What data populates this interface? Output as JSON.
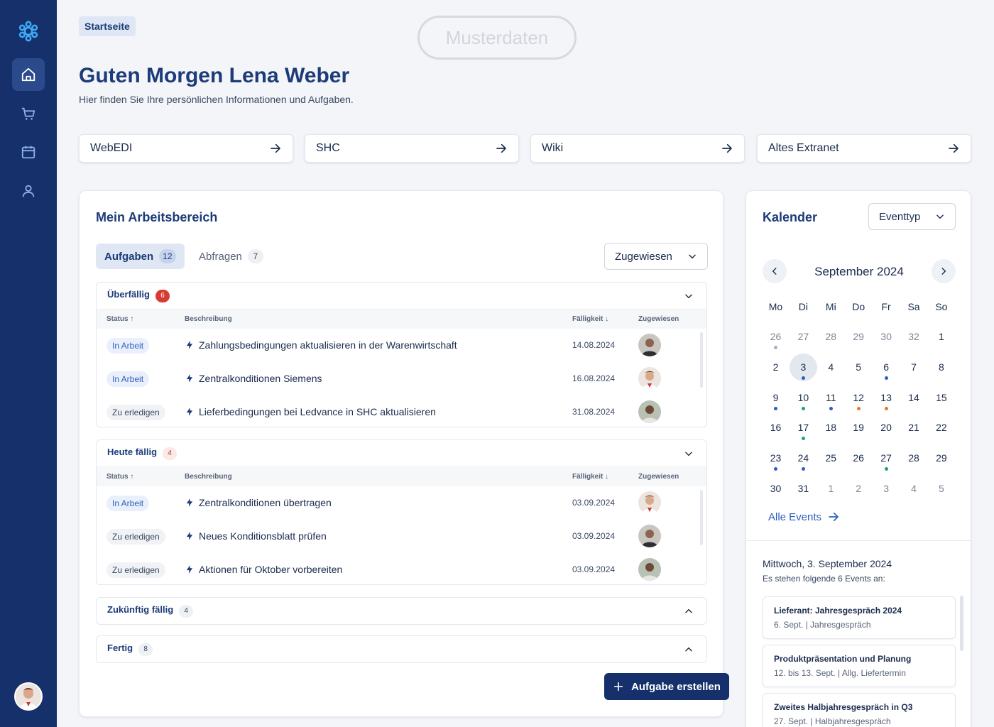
{
  "breadcrumb": "Startseite",
  "watermark": "Musterdaten",
  "greeting": "Guten Morgen Lena Weber",
  "subtitle": "Hier finden Sie Ihre persönlichen Informationen und Aufgaben.",
  "quicklinks": [
    {
      "label": "WebEDI"
    },
    {
      "label": "SHC"
    },
    {
      "label": "Wiki"
    },
    {
      "label": "Altes Extranet"
    }
  ],
  "workspace": {
    "title": "Mein Arbeitsbereich",
    "tabs": [
      {
        "label": "Aufgaben",
        "count": "12"
      },
      {
        "label": "Abfragen",
        "count": "7"
      }
    ],
    "filter": "Zugewiesen",
    "columns": {
      "status": "Status",
      "description": "Beschreibung",
      "due": "Fälligkeit",
      "assigned": "Zugewiesen"
    },
    "sections": [
      {
        "title": "Überfällig",
        "count": "6",
        "rows": [
          {
            "status": "In Arbeit",
            "description": "Zahlungsbedingungen aktualisieren in der Warenwirtschaft",
            "due": "14.08.2024"
          },
          {
            "status": "In Arbeit",
            "description": "Zentralkonditionen Siemens",
            "due": "16.08.2024"
          },
          {
            "status": "Zu erledigen",
            "description": "Lieferbedingungen bei Ledvance in SHC aktualisieren",
            "due": "31.08.2024"
          }
        ]
      },
      {
        "title": "Heute fällig",
        "count": "4",
        "rows": [
          {
            "status": "In Arbeit",
            "description": "Zentralkonditionen übertragen",
            "due": "03.09.2024"
          },
          {
            "status": "Zu erledigen",
            "description": "Neues Konditionsblatt prüfen",
            "due": "03.09.2024"
          },
          {
            "status": "Zu erledigen",
            "description": "Aktionen für Oktober vorbereiten",
            "due": "03.09.2024"
          }
        ]
      },
      {
        "title": "Zukünftig fällig",
        "count": "4"
      },
      {
        "title": "Fertig",
        "count": "8"
      }
    ],
    "create_button": "Aufgabe erstellen"
  },
  "calendar": {
    "title": "Kalender",
    "event_type": "Eventtyp",
    "month": "September 2024",
    "weekdays": [
      "Mo",
      "Di",
      "Mi",
      "Do",
      "Fr",
      "Sa",
      "So"
    ],
    "days": [
      [
        "26",
        "27",
        "28",
        "29",
        "30",
        "32",
        "1"
      ],
      [
        "2",
        "3",
        "4",
        "5",
        "6",
        "7",
        "8"
      ],
      [
        "9",
        "10",
        "11",
        "12",
        "13",
        "14",
        "15"
      ],
      [
        "16",
        "17",
        "18",
        "19",
        "20",
        "21",
        "22"
      ],
      [
        "23",
        "24",
        "25",
        "26",
        "27",
        "28",
        "29"
      ],
      [
        "30",
        "31",
        "1",
        "2",
        "3",
        "4",
        "5"
      ]
    ],
    "all_events": "Alle Events",
    "selected_date": "Mittwoch, 3. September 2024",
    "events_info": "Es stehen folgende 6 Events an:",
    "events": [
      {
        "title": "Lieferant: Jahresgespräch 2024",
        "sub": "6. Sept. | Jahresgespräch"
      },
      {
        "title": "Produktpräsentation und Planung",
        "sub": "12. bis 13. Sept. | Allg. Liefertermin"
      },
      {
        "title": "Zweites Halbjahresgespräch in Q3",
        "sub": "27. Sept.  | Halbjahresgespräch"
      }
    ]
  },
  "colors": {
    "navy": "#15306b",
    "accent": "#2d5fbf",
    "overdue": "#d83b33",
    "dot_blue": "#2d5fbf",
    "dot_green": "#1aa37a",
    "dot_orange": "#e07b2e"
  }
}
